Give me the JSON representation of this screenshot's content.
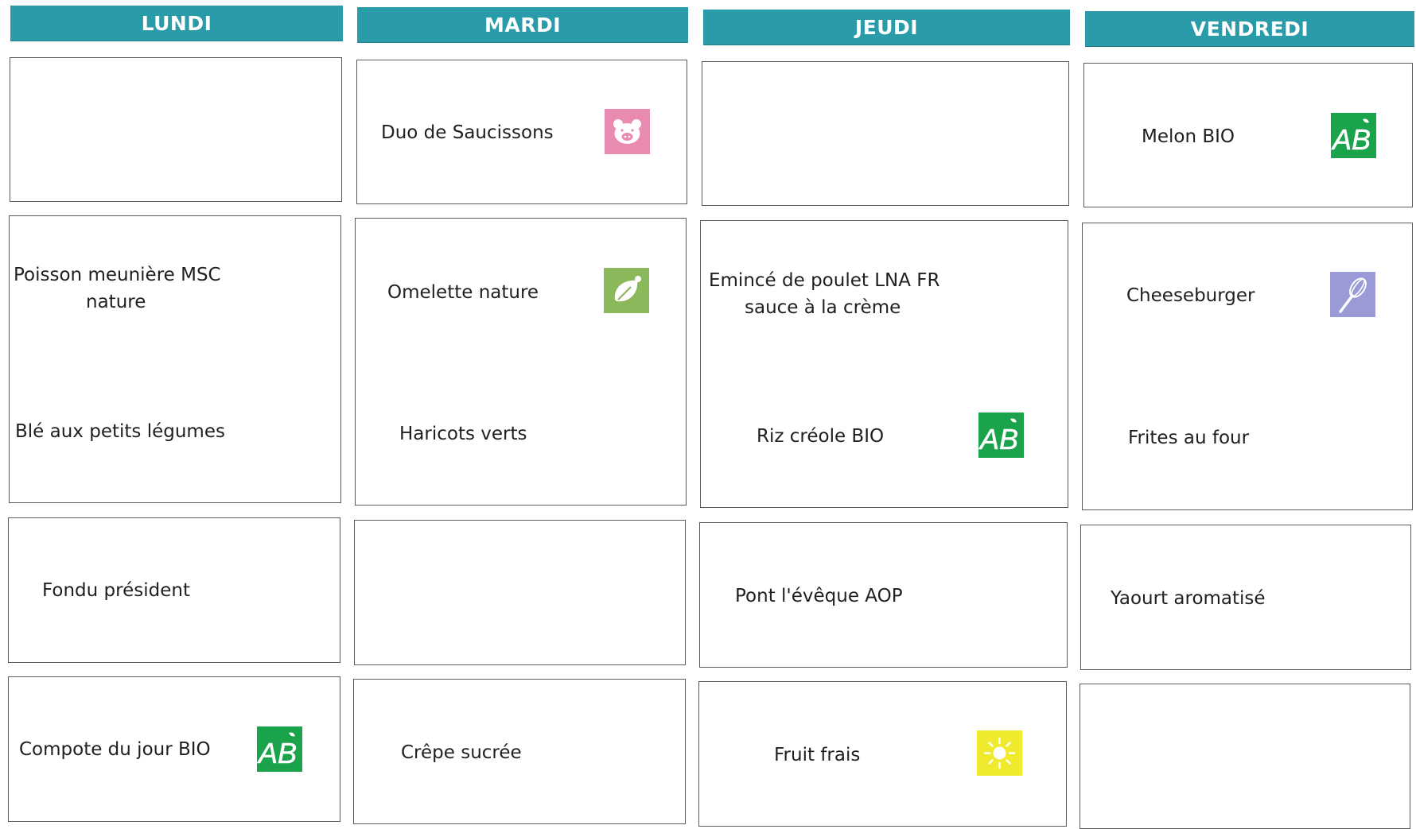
{
  "days": [
    "LUNDI",
    "MARDI",
    "JEUDI",
    "VENDREDI"
  ],
  "menu": {
    "lundi": {
      "entree": [],
      "plat": [
        "Poisson meunière MSC",
        "nature",
        "Blé aux petits légumes"
      ],
      "fromage": [
        "Fondu président"
      ],
      "dessert": [
        "Compote du jour BIO"
      ]
    },
    "mardi": {
      "entree": [
        "Duo de Saucissons"
      ],
      "plat": [
        "Omelette nature",
        "Haricots verts"
      ],
      "fromage": [],
      "dessert": [
        "Crêpe sucrée"
      ]
    },
    "jeudi": {
      "entree": [],
      "plat": [
        "Emincé de poulet LNA FR",
        "sauce à la crème",
        "Riz créole BIO"
      ],
      "fromage": [
        "Pont l'évêque AOP"
      ],
      "dessert": [
        "Fruit frais"
      ]
    },
    "vendredi": {
      "entree": [
        "Melon BIO"
      ],
      "plat": [
        "Cheeseburger",
        "Frites au four"
      ],
      "fromage": [
        "Yaourt aromatisé"
      ],
      "dessert": []
    }
  },
  "badges": {
    "pork": {
      "icon": "pig-icon",
      "color": "#e98ab0"
    },
    "vegetarian": {
      "icon": "leaf-icon",
      "color": "#8bb85a"
    },
    "homemade": {
      "icon": "whisk-icon",
      "color": "#9a9ad6"
    },
    "organic": {
      "icon": "ab-organic-icon",
      "color": "#1aa34a",
      "label": "AB"
    },
    "seasonal": {
      "icon": "sun-icon",
      "color": "#f0ea2e"
    }
  }
}
